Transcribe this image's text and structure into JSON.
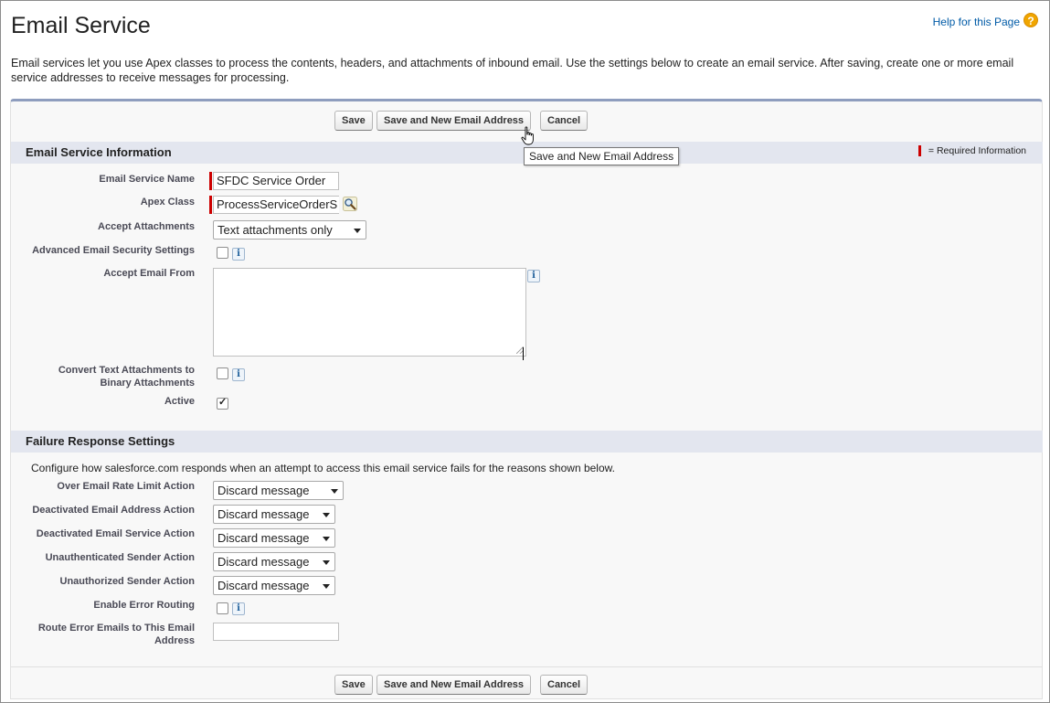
{
  "page": {
    "title": "Email Service",
    "help_link": "Help for this Page",
    "help_icon": "?",
    "intro": "Email services let you use Apex classes to process the contents, headers, and attachments of inbound email. Use the settings below to create an email service. After saving, create one or more email service addresses to receive messages for processing."
  },
  "buttons": {
    "save": "Save",
    "save_new": "Save and New Email Address",
    "cancel": "Cancel"
  },
  "tooltip": "Save and New Email Address",
  "info_section": {
    "title": "Email Service Information",
    "required_legend": "= Required Information",
    "fields": {
      "email_service_name": {
        "label": "Email Service Name",
        "value": "SFDC Service Order"
      },
      "apex_class": {
        "label": "Apex Class",
        "value": "ProcessServiceOrderS"
      },
      "accept_attachments": {
        "label": "Accept Attachments",
        "value": "Text attachments only"
      },
      "advanced_security": {
        "label": "Advanced Email Security Settings",
        "checked": false
      },
      "accept_email_from": {
        "label": "Accept Email From",
        "value": ""
      },
      "convert_text_attachments": {
        "label_line1": "Convert Text Attachments to",
        "label_line2": "Binary Attachments",
        "checked": false
      },
      "active": {
        "label": "Active",
        "checked": true
      }
    }
  },
  "failure_section": {
    "title": "Failure Response Settings",
    "description": "Configure how salesforce.com responds when an attempt to access this email service fails for the reasons shown below.",
    "actions": [
      {
        "label": "Over Email Rate Limit Action",
        "value": "Discard message"
      },
      {
        "label": "Deactivated Email Address Action",
        "value": "Discard message"
      },
      {
        "label": "Deactivated Email Service Action",
        "value": "Discard message"
      },
      {
        "label": "Unauthenticated Sender Action",
        "value": "Discard message"
      },
      {
        "label": "Unauthorized Sender Action",
        "value": "Discard message"
      }
    ],
    "enable_error_routing": {
      "label": "Enable Error Routing",
      "checked": false
    },
    "route_error_emails": {
      "label_line1": "Route Error Emails to This Email",
      "label_line2": "Address",
      "value": ""
    }
  },
  "icons": {
    "info": "i",
    "lookup": "magnifier-lookup-icon"
  },
  "colors": {
    "required": "#cc0000",
    "link": "#015ba7",
    "section_header": "#e3e6ef",
    "panel_top_border": "#8e9dbe"
  }
}
